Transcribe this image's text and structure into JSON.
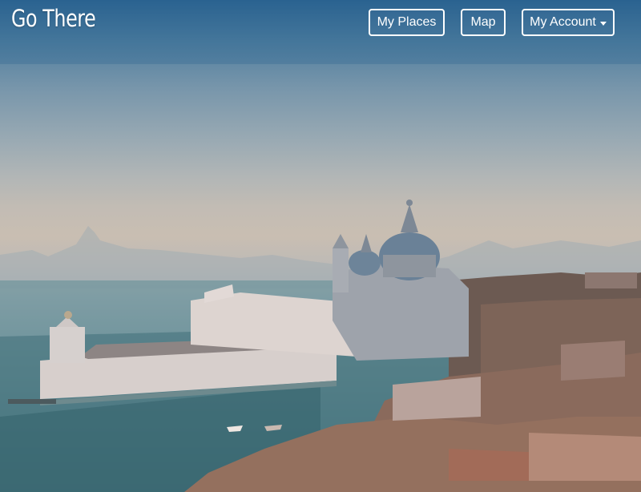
{
  "brand": {
    "name": "Go There"
  },
  "nav": {
    "my_places": "My Places",
    "map": "Map",
    "my_account": "My Account",
    "account_icon": "caret-down-icon"
  },
  "hero": {
    "image_subject": "venice-skyline-photo"
  }
}
